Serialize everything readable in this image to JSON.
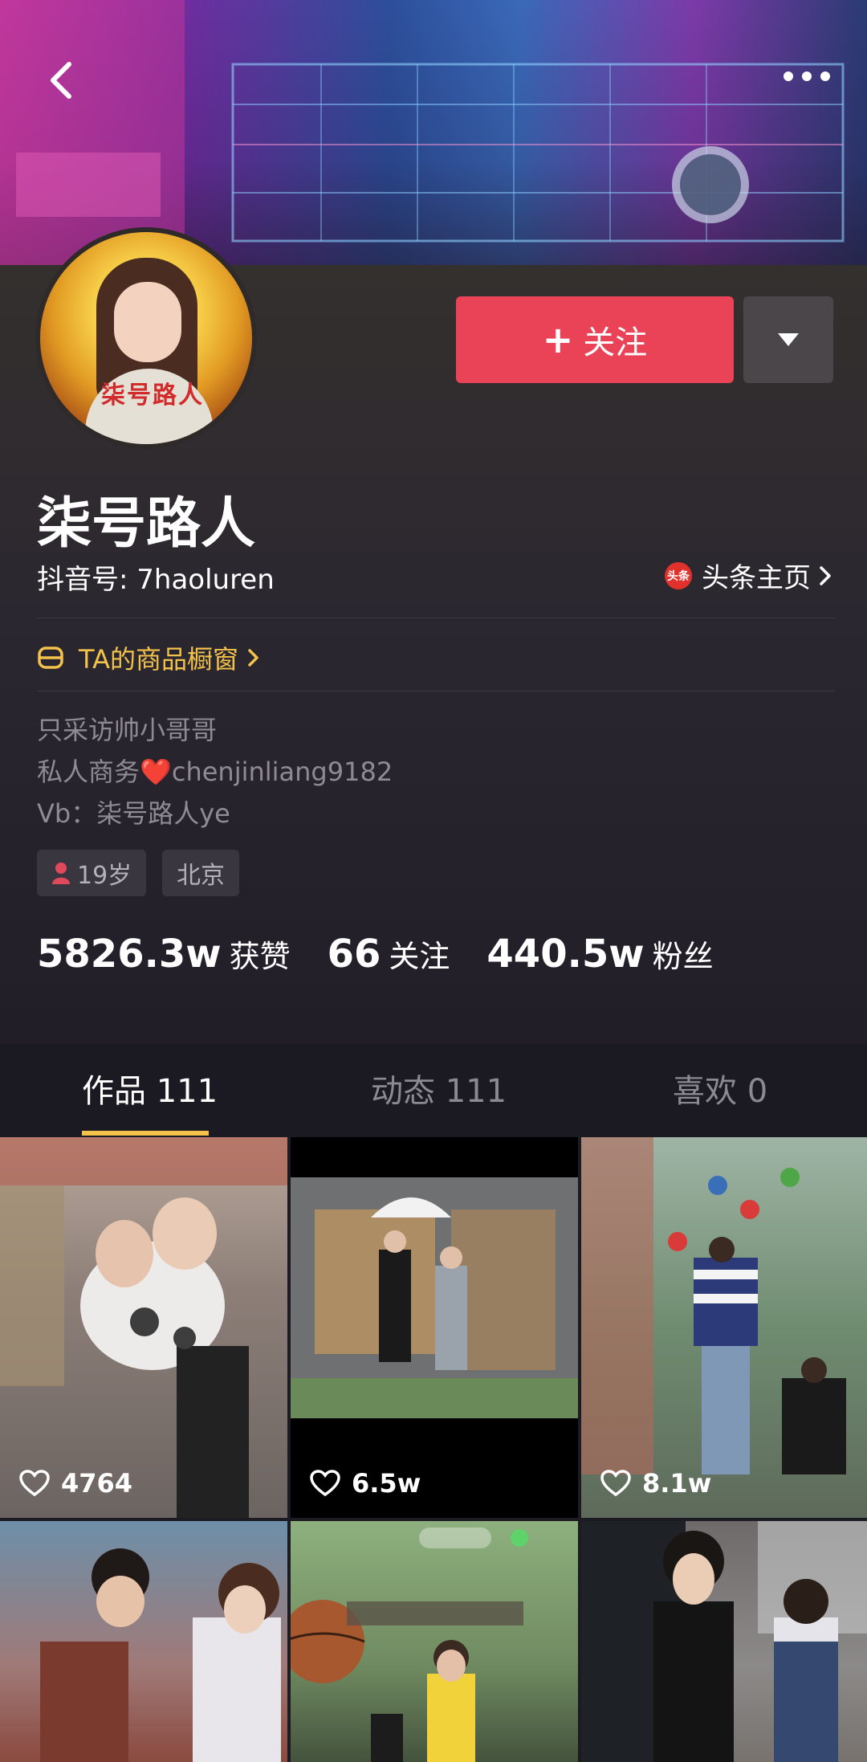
{
  "profile": {
    "name": "柒号路人",
    "douyin_id": "抖音号: 7haoluren",
    "toutiao_badge": "头条",
    "toutiao_label": "头条主页",
    "shop_label": "TA的商品橱窗",
    "avatar_caption": "柒号路人",
    "bio": [
      "只采访帅小哥哥",
      "私人商务❤️chenjinliang9182",
      "Vb：柒号路人ye"
    ],
    "tags": [
      "19岁",
      "北京"
    ]
  },
  "actions": {
    "follow_plus": "+",
    "follow_label": "关注"
  },
  "stats": [
    {
      "value": "5826.3w",
      "label": "获赞"
    },
    {
      "value": "66",
      "label": "关注"
    },
    {
      "value": "440.5w",
      "label": "粉丝"
    }
  ],
  "tabs": [
    {
      "label": "作品 111",
      "active": true
    },
    {
      "label": "动态 111",
      "active": false
    },
    {
      "label": "喜欢 0",
      "active": false
    }
  ],
  "videos": [
    {
      "likes": "4764"
    },
    {
      "likes": "6.5w"
    },
    {
      "likes": "8.1w"
    },
    {
      "likes": ""
    },
    {
      "likes": ""
    },
    {
      "likes": ""
    }
  ],
  "icons": {
    "back": "chevron-left-icon",
    "more": "more-dots-icon",
    "dropdown": "triangle-down-icon",
    "shop": "shop-bag-icon",
    "heart": "heart-outline-icon",
    "gender": "person-icon"
  },
  "colors": {
    "accent": "#ea4256",
    "gold": "#f2c24a",
    "background": "#1c1a22"
  }
}
